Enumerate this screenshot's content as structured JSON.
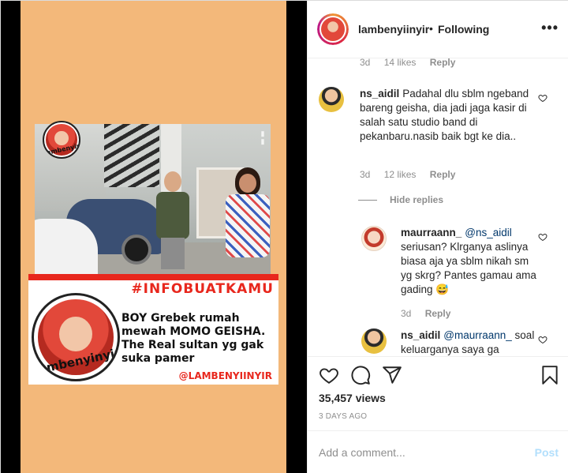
{
  "colors": {
    "accent_red": "#e8271d",
    "canvas": "#f3b87a",
    "link": "#00376b",
    "post_disabled": "#b2dffc",
    "muted": "#8e8e8e"
  },
  "media": {
    "logo_text": "lambenyinyir",
    "hashtag": "#INFOBUATKAMU",
    "headline": "BOY Grebek rumah mewah MOMO GEISHA. The Real sultan yg gak suka pamer",
    "handle_tag": "@LAMBENYIINYIR"
  },
  "header": {
    "username": "lambenyiinyir",
    "separator": "•",
    "follow_status": "Following",
    "more_icon": "more-horizontal-icon"
  },
  "comments": {
    "top_meta": {
      "age": "3d",
      "likes": "14 likes",
      "reply": "Reply"
    },
    "items": [
      {
        "user": "ns_aidil",
        "text": "Padahal dlu sblm ngeband bareng geisha, dia jadi jaga kasir di salah satu studio band di pekanbaru.nasib baik bgt ke dia..",
        "age": "3d",
        "likes": "12 likes",
        "reply": "Reply"
      }
    ],
    "hide_replies": "Hide replies",
    "replies": [
      {
        "user": "maurraann_",
        "mention": "@ns_aidil",
        "text": "seriusan? Klrganya aslinya biasa aja ya sblm nikah sm yg skrg? Pantes gamau ama gading 😅",
        "age": "3d",
        "reply": "Reply"
      },
      {
        "user": "ns_aidil",
        "mention": "@maurraann_",
        "text": "soal keluarganya saya ga"
      }
    ]
  },
  "actions": {
    "views": "35,457 views",
    "date": "3 DAYS AGO"
  },
  "composer": {
    "placeholder": "Add a comment...",
    "post_label": "Post"
  }
}
